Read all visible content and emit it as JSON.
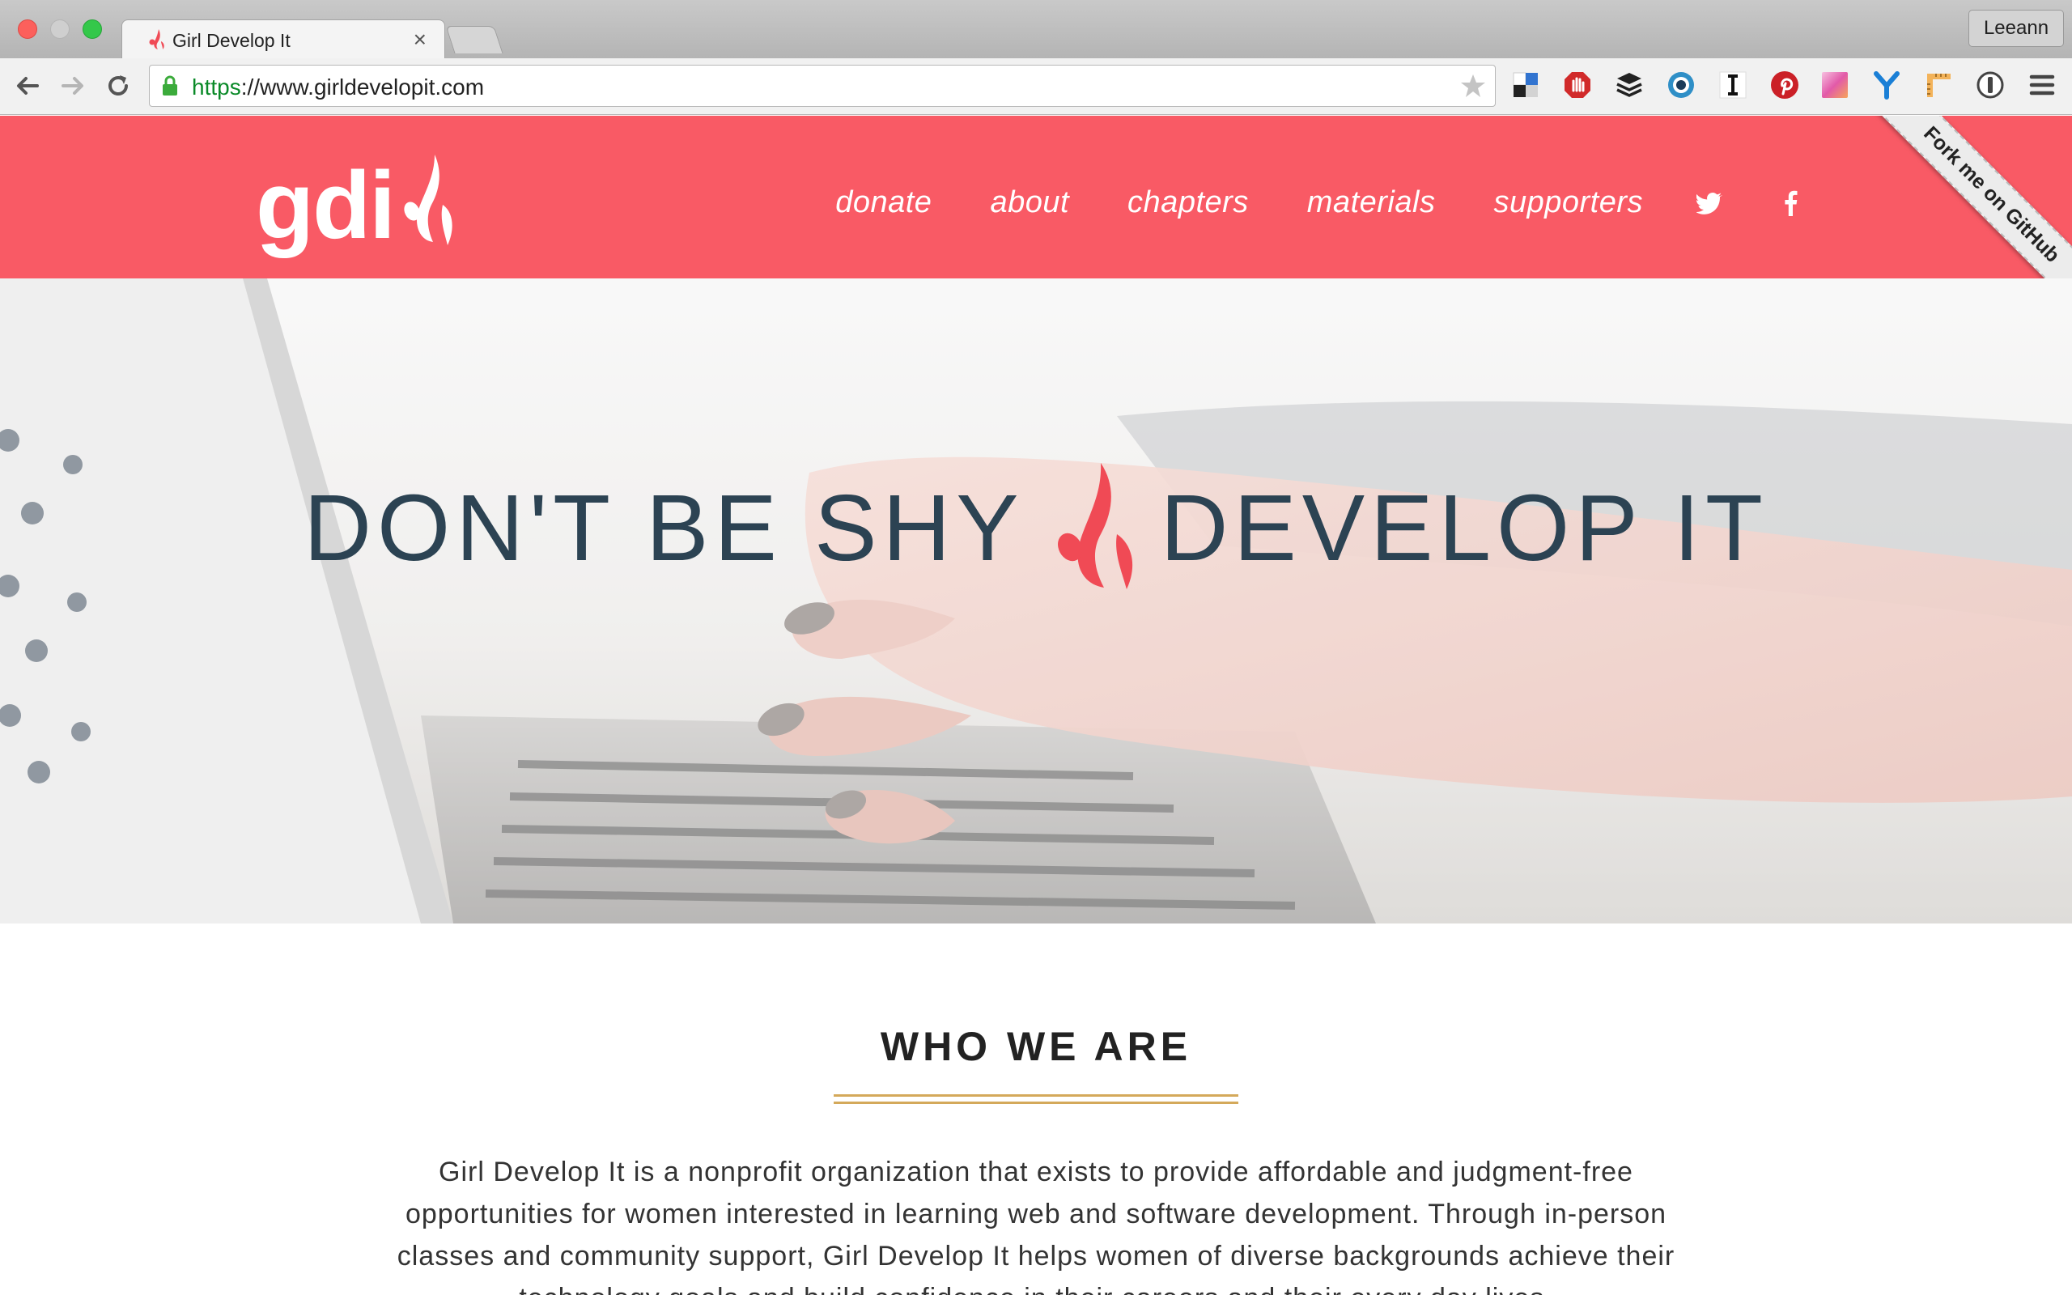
{
  "browser": {
    "tab_title": "Girl Develop It",
    "tab_close": "×",
    "profile_name": "Leeann",
    "url_scheme": "https",
    "url_rest": "://www.girldevelopit.com",
    "extensions": [
      "delicious-icon",
      "adblock-icon",
      "buffer-icon",
      "eye-icon",
      "instapaper-icon",
      "pinterest-icon",
      "color-picker-icon",
      "y-icon",
      "ruler-icon",
      "onepassword-icon",
      "menu-icon"
    ]
  },
  "header": {
    "logo_text": "gdi",
    "nav": [
      "donate",
      "about",
      "chapters",
      "materials",
      "supporters"
    ],
    "social": [
      "twitter-icon",
      "facebook-icon"
    ],
    "ribbon": "Fork me on GitHub",
    "accent": "#f95a65"
  },
  "hero": {
    "left": "DON'T BE SHY",
    "right": "DEVELOP IT"
  },
  "who": {
    "title": "WHO WE ARE",
    "body": "Girl Develop It is a nonprofit organization that exists to provide affordable and judgment-free opportunities for women interested in learning web and software development. Through in-person classes and community support, Girl Develop It helps women of diverse backgrounds achieve their technology goals and build confidence in their careers and their every day lives.",
    "rule_color": "#d4a95a"
  }
}
